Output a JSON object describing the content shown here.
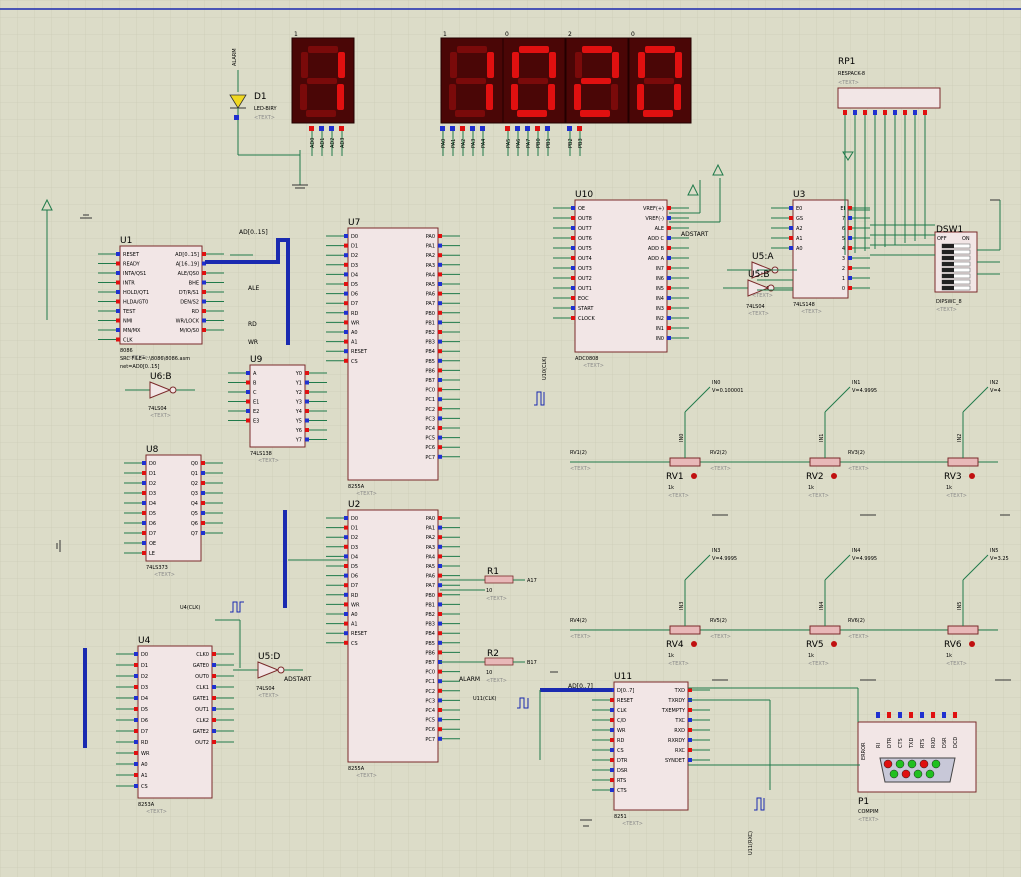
{
  "display": {
    "digits": [
      "1",
      "1",
      "0",
      "2",
      "0"
    ],
    "labels": [
      "AD0",
      "AD1",
      "AD2",
      "AD3",
      "PA0",
      "PA1",
      "PA2",
      "PA3",
      "PA4",
      "PA5",
      "PA6",
      "PA7",
      "PB0",
      "PB1",
      "PB2",
      "PB3"
    ]
  },
  "led": {
    "ref": "D1",
    "type": "LED-BIRY",
    "net": "ALARM"
  },
  "rp1": {
    "ref": "RP1",
    "type": "RESPACK-8"
  },
  "dsw": {
    "ref": "DSW1",
    "type": "DIPSWC_8",
    "on": "ON",
    "off": "OFF"
  },
  "text_placeholder": "<TEXT>",
  "chips": {
    "u1": {
      "ref": "U1",
      "type": "8086",
      "extra1": "SRC FILE=..\\8086\\8086.asm",
      "extra2": "net=AD0[0..15]",
      "left_pins": [
        "RESET",
        "READY",
        "INTA/QS1",
        "INTR",
        "HOLD/QT1",
        "HLDA/GT0",
        "TEST",
        "NMI",
        "MN/MX",
        "CLK"
      ],
      "right_pins": [
        "AD[0..15]",
        "A[16..19]",
        "ALE/QS0",
        "BHE",
        "DT/R/S1",
        "DEN/S2",
        "RD",
        "WR/LOCK",
        "M/IO/S0"
      ]
    },
    "u9": {
      "ref": "U9",
      "type": "74LS138",
      "left_pins": [
        "A",
        "B",
        "C",
        "E1",
        "E2",
        "E3"
      ],
      "right_pins": [
        "Y0",
        "Y1",
        "Y2",
        "Y3",
        "Y4",
        "Y5",
        "Y6",
        "Y7"
      ]
    },
    "u8": {
      "ref": "U8",
      "type": "74LS373",
      "left_pins": [
        "D0",
        "D1",
        "D2",
        "D3",
        "D4",
        "D5",
        "D6",
        "D7",
        "OE",
        "LE"
      ],
      "right_pins": [
        "Q0",
        "Q1",
        "Q2",
        "Q3",
        "Q4",
        "Q5",
        "Q6",
        "Q7"
      ]
    },
    "u7": {
      "ref": "U7",
      "type": "8255A",
      "left_pins": [
        "D0",
        "D1",
        "D2",
        "D3",
        "D4",
        "D5",
        "D6",
        "D7",
        "RD",
        "WR",
        "A0",
        "A1",
        "RESET",
        "CS"
      ],
      "right_pins": [
        "PA0",
        "PA1",
        "PA2",
        "PA3",
        "PA4",
        "PA5",
        "PA6",
        "PA7",
        "PB0",
        "PB1",
        "PB2",
        "PB3",
        "PB4",
        "PB5",
        "PB6",
        "PB7",
        "PC0",
        "PC1",
        "PC2",
        "PC3",
        "PC4",
        "PC5",
        "PC6",
        "PC7"
      ]
    },
    "u2": {
      "ref": "U2",
      "type": "8255A",
      "left_pins": [
        "D0",
        "D1",
        "D2",
        "D3",
        "D4",
        "D5",
        "D6",
        "D7",
        "RD",
        "WR",
        "A0",
        "A1",
        "RESET",
        "CS"
      ],
      "right_pins": [
        "PA0",
        "PA1",
        "PA2",
        "PA3",
        "PA4",
        "PA5",
        "PA6",
        "PA7",
        "PB0",
        "PB1",
        "PB2",
        "PB3",
        "PB4",
        "PB5",
        "PB6",
        "PB7",
        "PC0",
        "PC1",
        "PC2",
        "PC3",
        "PC4",
        "PC5",
        "PC6",
        "PC7"
      ]
    },
    "u4": {
      "ref": "U4",
      "type": "8253A",
      "left_pins": [
        "D0",
        "D1",
        "D2",
        "D3",
        "D4",
        "D5",
        "D6",
        "D7",
        "RD",
        "WR",
        "A0",
        "A1",
        "CS"
      ],
      "right_pins": [
        "CLK0",
        "GATE0",
        "OUT0",
        "CLK1",
        "GATE1",
        "OUT1",
        "CLK2",
        "GATE2",
        "OUT2"
      ]
    },
    "u10": {
      "ref": "U10",
      "type": "ADC0808",
      "left_pins": [
        "OE",
        "OUT8",
        "OUT7",
        "OUT6",
        "OUT5",
        "OUT4",
        "OUT3",
        "OUT2",
        "OUT1",
        "EOC",
        "START",
        "CLOCK"
      ],
      "right_pins": [
        "VREF(+)",
        "VREF(-)",
        "ALE",
        "ADD C",
        "ADD B",
        "ADD A",
        "IN7",
        "IN6",
        "IN5",
        "IN4",
        "IN3",
        "IN2",
        "IN1",
        "IN0"
      ]
    },
    "u3": {
      "ref": "U3",
      "type": "74LS148",
      "left_pins": [
        "E0",
        "GS",
        "A2",
        "A1",
        "A0"
      ],
      "right_pins": [
        "EI",
        "7",
        "6",
        "5",
        "4",
        "3",
        "2",
        "1",
        "0"
      ]
    },
    "u11": {
      "ref": "U11",
      "type": "8251",
      "left_pins": [
        "D[0..7]",
        "RESET",
        "CLK",
        "C/D",
        "WR",
        "RD",
        "CS",
        "DTR",
        "DSR",
        "RTS",
        "CTS"
      ],
      "right_pins": [
        "TXD",
        "TXRDY",
        "TXEMPTY",
        "TXC",
        "RXD",
        "RXRDY",
        "RXC",
        "SYNDET"
      ]
    }
  },
  "gates": {
    "u6b": {
      "ref": "U6:B",
      "type": "74LS04"
    },
    "u5d": {
      "ref": "U5:D",
      "type": "74LS04"
    },
    "u5a": {
      "ref": "U5:A",
      "type": "74LS04"
    },
    "u5b": {
      "ref": "U5:B",
      "type": "74LS04"
    }
  },
  "pots": [
    {
      "ref": "RV1",
      "val": "1k",
      "net": "IN0",
      "voltage": "V=0.100001"
    },
    {
      "ref": "RV2",
      "val": "1k",
      "net": "IN1",
      "voltage": "V=4.9995"
    },
    {
      "ref": "RV3",
      "val": "1k",
      "net": "IN2",
      "voltage": "V=4"
    },
    {
      "ref": "RV4",
      "val": "1k",
      "net": "IN3",
      "voltage": "V=4.9995"
    },
    {
      "ref": "RV5",
      "val": "1k",
      "net": "IN4",
      "voltage": "V=4.9995"
    },
    {
      "ref": "RV6",
      "val": "1k",
      "net": "IN5",
      "voltage": "V=3.25"
    }
  ],
  "resistors": {
    "r1": {
      "ref": "R1",
      "val": "10",
      "net": "A17"
    },
    "r2": {
      "ref": "R2",
      "val": "10",
      "net": "B17"
    }
  },
  "comport": {
    "ref": "P1",
    "type": "COMPIM",
    "pins": [
      "RI",
      "DTR",
      "CTS",
      "TXD",
      "RTS",
      "RXD",
      "DSR",
      "DCD"
    ],
    "error": "ERROR"
  },
  "nets": {
    "ad_bus": "AD[0..15]",
    "ale": "ALE",
    "rd": "RD",
    "wr": "WR",
    "adstart": "ADSTART",
    "alarm": "ALARM",
    "u10clk": "U10(CLK)",
    "u4clk": "U4(CLK)",
    "u11clk": "U11(CLK)",
    "u11rxc": "U11(RXC)",
    "adbus07": "AD[0..7]"
  }
}
